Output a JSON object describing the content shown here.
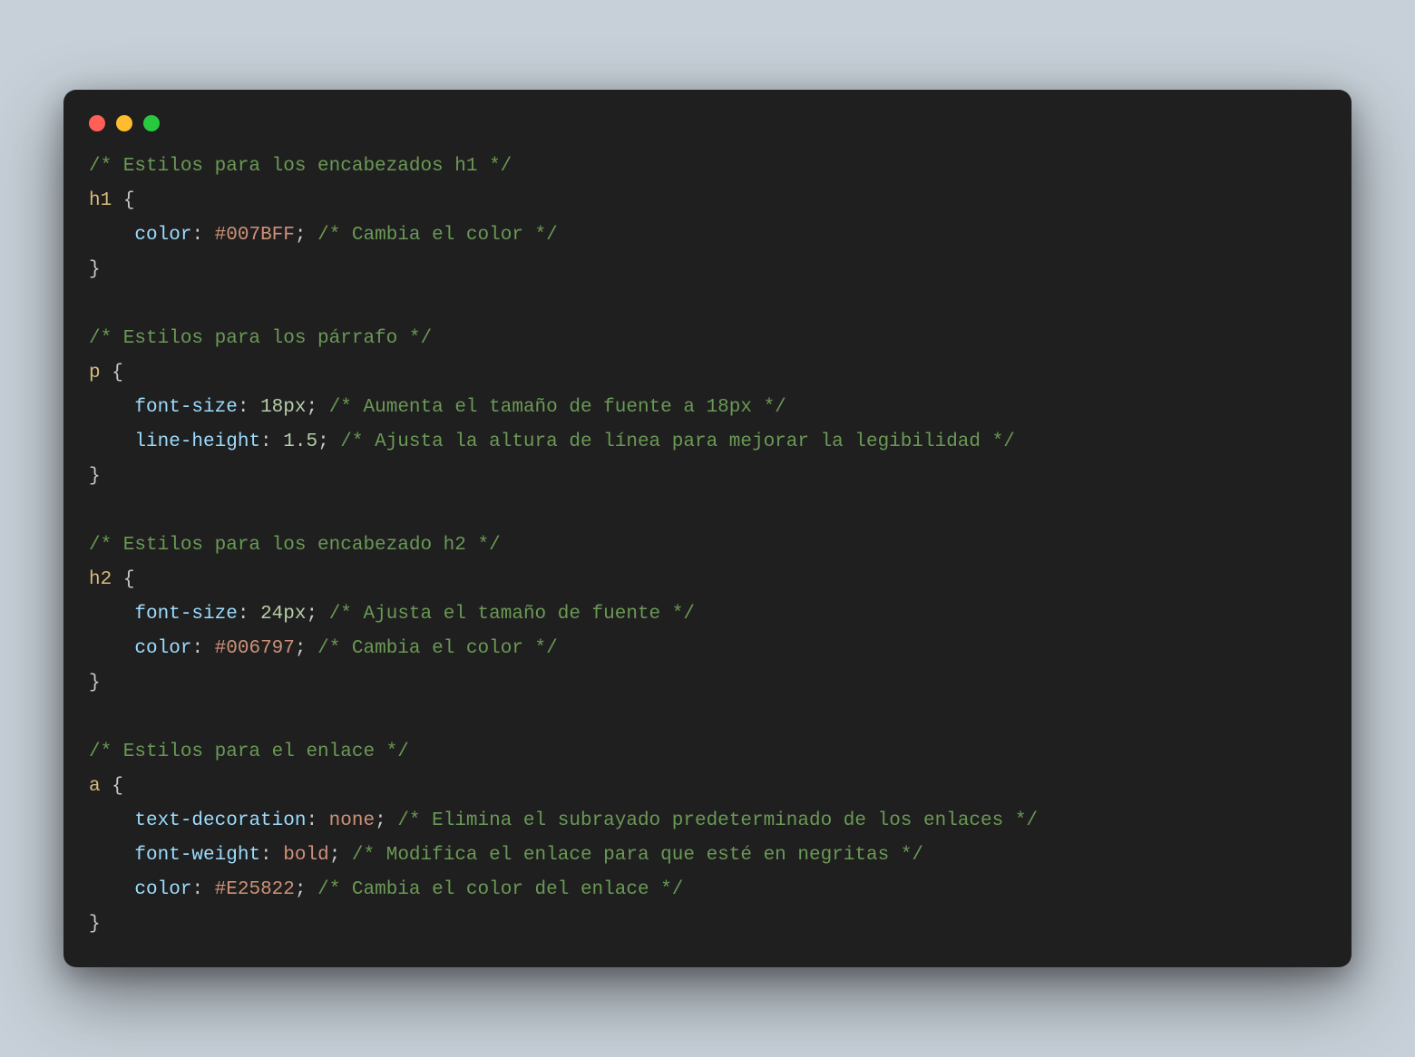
{
  "lines": [
    [
      {
        "cls": "c",
        "t": "/* Estilos para los encabezados h1 */"
      }
    ],
    [
      {
        "cls": "s",
        "t": "h1"
      },
      {
        "cls": "b",
        "t": " {"
      }
    ],
    [
      {
        "cls": "b",
        "t": "    "
      },
      {
        "cls": "p",
        "t": "color"
      },
      {
        "cls": "co",
        "t": ": "
      },
      {
        "cls": "v",
        "t": "#007BFF"
      },
      {
        "cls": "co",
        "t": "; "
      },
      {
        "cls": "c",
        "t": "/* Cambia el color */"
      }
    ],
    [
      {
        "cls": "b",
        "t": "}"
      }
    ],
    [],
    [
      {
        "cls": "c",
        "t": "/* Estilos para los párrafo */"
      }
    ],
    [
      {
        "cls": "s",
        "t": "p"
      },
      {
        "cls": "b",
        "t": " {"
      }
    ],
    [
      {
        "cls": "b",
        "t": "    "
      },
      {
        "cls": "p",
        "t": "font-size"
      },
      {
        "cls": "co",
        "t": ": "
      },
      {
        "cls": "n",
        "t": "18px"
      },
      {
        "cls": "co",
        "t": "; "
      },
      {
        "cls": "c",
        "t": "/* Aumenta el tamaño de fuente a 18px */"
      }
    ],
    [
      {
        "cls": "b",
        "t": "    "
      },
      {
        "cls": "p",
        "t": "line-height"
      },
      {
        "cls": "co",
        "t": ": "
      },
      {
        "cls": "n",
        "t": "1.5"
      },
      {
        "cls": "co",
        "t": "; "
      },
      {
        "cls": "c",
        "t": "/* Ajusta la altura de línea para mejorar la legibilidad */"
      }
    ],
    [
      {
        "cls": "b",
        "t": "}"
      }
    ],
    [],
    [
      {
        "cls": "c",
        "t": "/* Estilos para los encabezado h2 */"
      }
    ],
    [
      {
        "cls": "s",
        "t": "h2"
      },
      {
        "cls": "b",
        "t": " {"
      }
    ],
    [
      {
        "cls": "b",
        "t": "    "
      },
      {
        "cls": "p",
        "t": "font-size"
      },
      {
        "cls": "co",
        "t": ": "
      },
      {
        "cls": "n",
        "t": "24px"
      },
      {
        "cls": "co",
        "t": "; "
      },
      {
        "cls": "c",
        "t": "/* Ajusta el tamaño de fuente */"
      }
    ],
    [
      {
        "cls": "b",
        "t": "    "
      },
      {
        "cls": "p",
        "t": "color"
      },
      {
        "cls": "co",
        "t": ": "
      },
      {
        "cls": "v",
        "t": "#006797"
      },
      {
        "cls": "co",
        "t": "; "
      },
      {
        "cls": "c",
        "t": "/* Cambia el color */"
      }
    ],
    [
      {
        "cls": "b",
        "t": "}"
      }
    ],
    [],
    [
      {
        "cls": "c",
        "t": "/* Estilos para el enlace */"
      }
    ],
    [
      {
        "cls": "s",
        "t": "a"
      },
      {
        "cls": "b",
        "t": " {"
      }
    ],
    [
      {
        "cls": "b",
        "t": "    "
      },
      {
        "cls": "p",
        "t": "text-decoration"
      },
      {
        "cls": "co",
        "t": ": "
      },
      {
        "cls": "v",
        "t": "none"
      },
      {
        "cls": "co",
        "t": "; "
      },
      {
        "cls": "c",
        "t": "/* Elimina el subrayado predeterminado de los enlaces */"
      }
    ],
    [
      {
        "cls": "b",
        "t": "    "
      },
      {
        "cls": "p",
        "t": "font-weight"
      },
      {
        "cls": "co",
        "t": ": "
      },
      {
        "cls": "v",
        "t": "bold"
      },
      {
        "cls": "co",
        "t": "; "
      },
      {
        "cls": "c",
        "t": "/* Modifica el enlace para que esté en negritas */"
      }
    ],
    [
      {
        "cls": "b",
        "t": "    "
      },
      {
        "cls": "p",
        "t": "color"
      },
      {
        "cls": "co",
        "t": ": "
      },
      {
        "cls": "v",
        "t": "#E25822"
      },
      {
        "cls": "co",
        "t": "; "
      },
      {
        "cls": "c",
        "t": "/* Cambia el color del enlace */"
      }
    ],
    [
      {
        "cls": "b",
        "t": "}"
      }
    ]
  ]
}
